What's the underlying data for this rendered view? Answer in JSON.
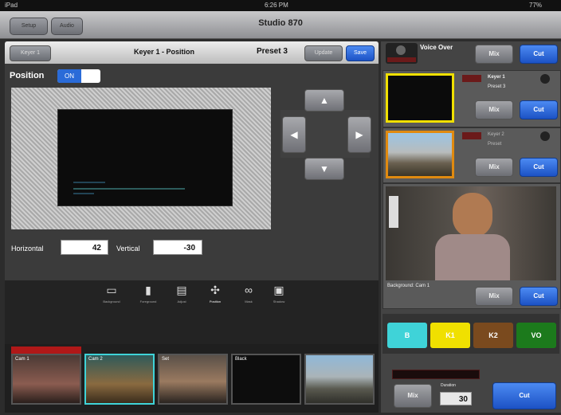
{
  "status": {
    "left": "iPad",
    "time": "6:26 PM",
    "battery": "77%"
  },
  "nav": {
    "title": "Studio 870",
    "left_btn1": "Setup",
    "left_btn2": "Audio"
  },
  "keyer": {
    "title": "Keyer 1 - Position",
    "back_label": "Keyer 1",
    "preset_label": "Preset 3",
    "update_label": "Update",
    "save_label": "Save",
    "position_label": "Position",
    "toggle_state": "ON",
    "horizontal_label": "Horizontal",
    "horizontal_value": "42",
    "vertical_label": "Vertical",
    "vertical_value": "-30"
  },
  "tools": [
    {
      "label": "Background",
      "icon": "background-icon"
    },
    {
      "label": "Foreground",
      "icon": "foreground-icon"
    },
    {
      "label": "Adjust",
      "icon": "adjust-icon"
    },
    {
      "label": "Position",
      "icon": "position-icon"
    },
    {
      "label": "Mask",
      "icon": "mask-icon"
    },
    {
      "label": "Shadow",
      "icon": "shadow-icon"
    }
  ],
  "thumbnails": [
    {
      "caption": "Cam 1"
    },
    {
      "caption": "Cam 2"
    },
    {
      "caption": "Set"
    },
    {
      "caption": "Black"
    },
    {
      "caption": ""
    }
  ],
  "right": {
    "voice_over": "Voice Over",
    "mix": "Mix",
    "cut": "Cut",
    "keyer1_name": "Keyer 1",
    "keyer1_preset": "Preset 3",
    "keyer2_name": "Keyer 2",
    "keyer2_preset": "Preset",
    "background_cam": "Background: Cam 1",
    "btn_b": "B",
    "btn_k1": "K1",
    "btn_k2": "K2",
    "btn_vo": "VO",
    "duration_label": "Duration",
    "duration_value": "30"
  },
  "colors": {
    "accent_blue": "#2a6bd8",
    "highlight_yellow": "#f0e000",
    "k2_brown": "#7a4a1e",
    "vo_green": "#1c7a1c",
    "b_cyan": "#3fd3d8"
  }
}
